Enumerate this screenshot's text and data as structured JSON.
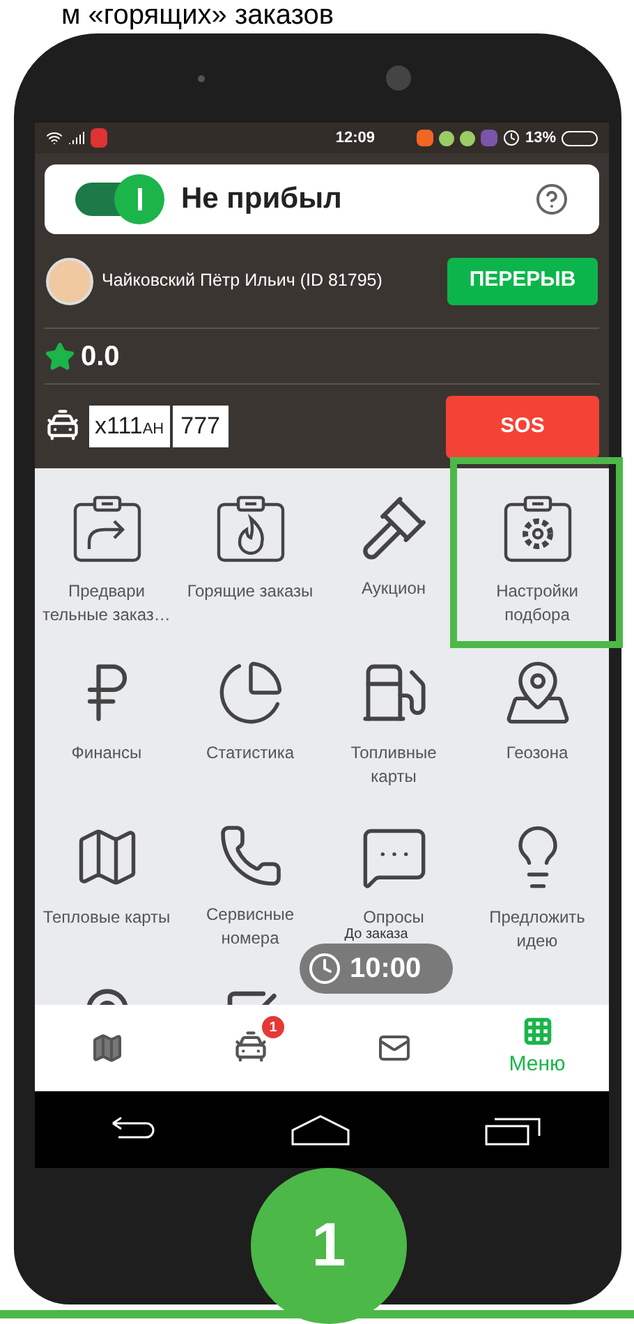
{
  "heading": "м «горящих» заказов",
  "status_bar": {
    "time": "12:09",
    "battery": "13%"
  },
  "status_toggle": {
    "on": true,
    "label": "Не прибыл"
  },
  "driver": {
    "name": "Чайковский Пётр Ильич (ID 81795)",
    "break_button": "ПЕРЕРЫВ"
  },
  "rating": "0.0",
  "plate": {
    "number": "х111",
    "letters": "АН",
    "region": "777"
  },
  "sos_button": "SOS",
  "menu_items": [
    {
      "label": "Предвари тельные заказ…",
      "highlighted": false
    },
    {
      "label": "Горящие заказы",
      "highlighted": false
    },
    {
      "label": "Аукцион",
      "highlighted": false
    },
    {
      "label": "Настройки подбора",
      "highlighted": true
    },
    {
      "label": "Финансы",
      "highlighted": false
    },
    {
      "label": "Статистика",
      "highlighted": false
    },
    {
      "label": "Топливные карты",
      "highlighted": false
    },
    {
      "label": "Геозона",
      "highlighted": false
    },
    {
      "label": "Тепловые карты",
      "highlighted": false
    },
    {
      "label": "Сервисные номера",
      "highlighted": false
    },
    {
      "label": "Опросы",
      "highlighted": false
    },
    {
      "label": "Предложить идею",
      "highlighted": false
    }
  ],
  "timer": {
    "caption": "До заказа",
    "time": "10:00"
  },
  "bottom_nav": [
    {
      "kind": "map",
      "selected": false
    },
    {
      "kind": "taxi",
      "selected": false,
      "badge": "1"
    },
    {
      "kind": "mail",
      "selected": false
    },
    {
      "kind": "menu",
      "selected": true,
      "label": "Меню"
    }
  ],
  "step_number": "1"
}
